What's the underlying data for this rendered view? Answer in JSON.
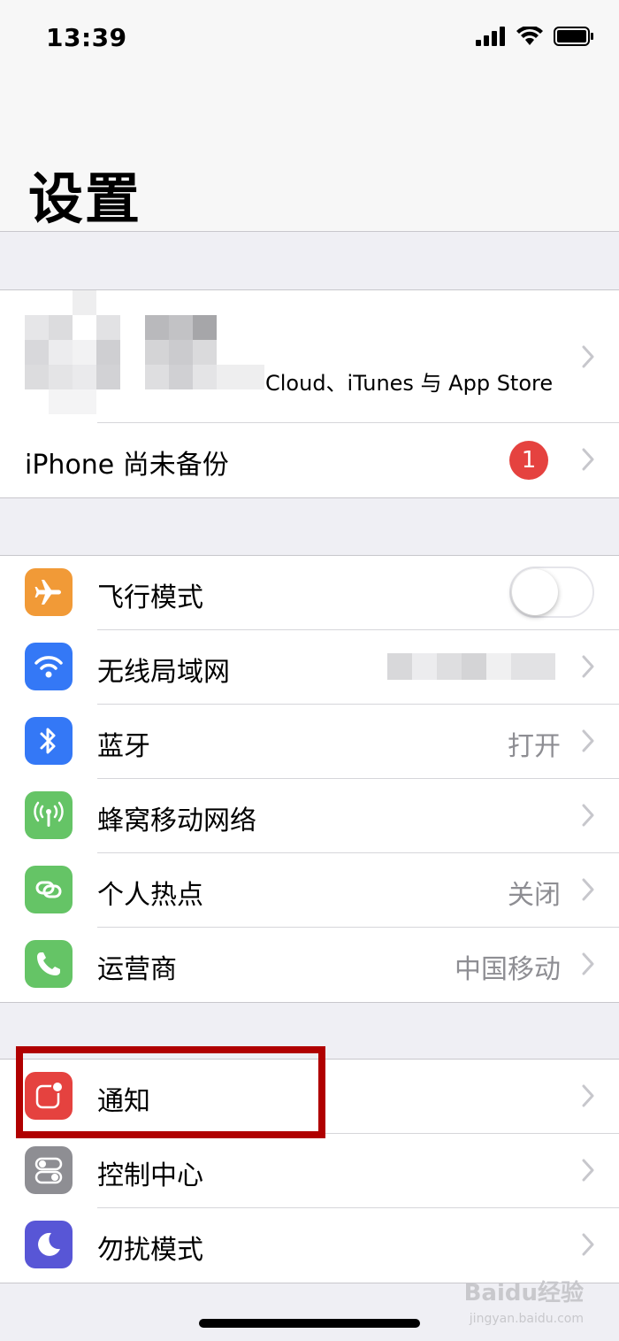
{
  "status": {
    "time": "13:39"
  },
  "nav": {
    "title": "设置"
  },
  "account": {
    "subtitle": "Cloud、iTunes 与 App Store"
  },
  "backup": {
    "label": "iPhone 尚未备份",
    "badge": "1"
  },
  "connectivity": [
    {
      "label": "飞行模式",
      "icon": "airplane-icon",
      "color": "#f19a37",
      "toggle": false
    },
    {
      "label": "无线局域网",
      "icon": "wifi-icon",
      "color": "#3478f6",
      "value": ""
    },
    {
      "label": "蓝牙",
      "icon": "bluetooth-icon",
      "color": "#3478f6",
      "value": "打开"
    },
    {
      "label": "蜂窝移动网络",
      "icon": "cellular-icon",
      "color": "#65c466",
      "value": ""
    },
    {
      "label": "个人热点",
      "icon": "hotspot-icon",
      "color": "#65c466",
      "value": "关闭"
    },
    {
      "label": "运营商",
      "icon": "phone-icon",
      "color": "#65c466",
      "value": "中国移动"
    }
  ],
  "system": [
    {
      "label": "通知",
      "icon": "notifications-icon",
      "color": "#e5423f"
    },
    {
      "label": "控制中心",
      "icon": "control-center-icon",
      "color": "#8e8e93"
    },
    {
      "label": "勿扰模式",
      "icon": "moon-icon",
      "color": "#5856d6"
    }
  ],
  "watermark": {
    "brand": "Baidu经验",
    "url": "jingyan.baidu.com"
  }
}
